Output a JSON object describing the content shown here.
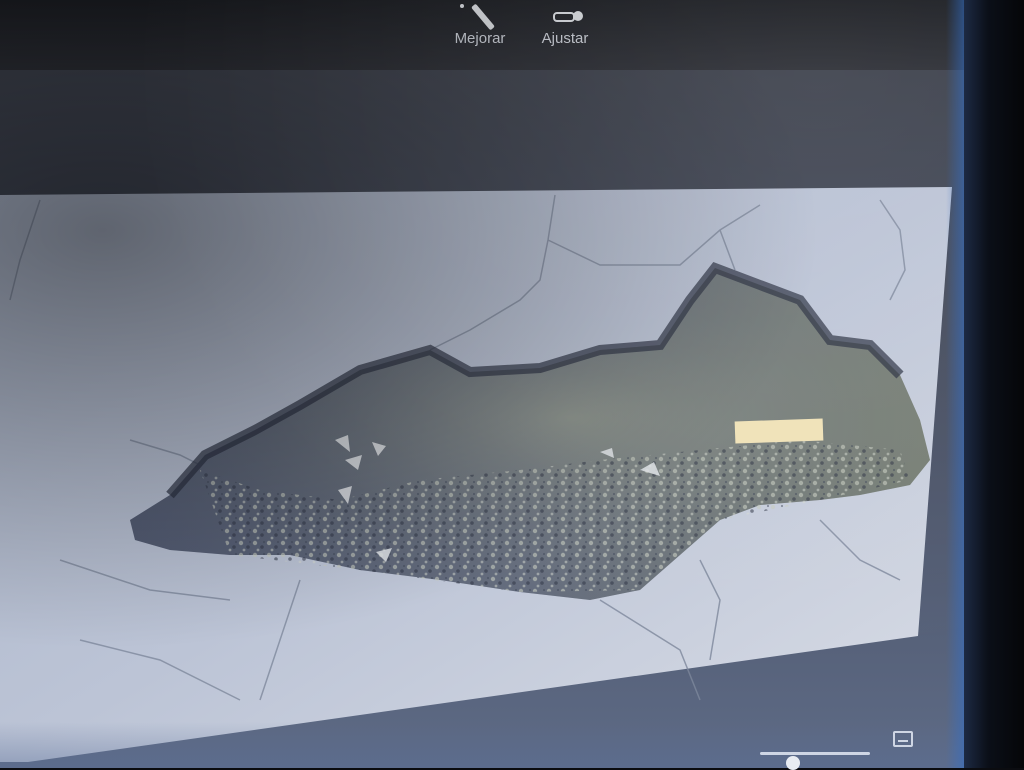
{
  "toolbar": {
    "enhance_label": "Mejorar",
    "adjust_label": "Ajustar",
    "enhance_icon": "magic-wand-icon",
    "adjust_icon": "adjust-sliders-icon"
  },
  "viewer": {
    "photo_subject": "",
    "fit_icon": "fit-to-window-icon"
  },
  "colors": {
    "toolbar_bg": "#1f2127",
    "toolbar_text": "#c8ccd4",
    "viewer_bg": "#4c5468",
    "photo_asphalt": "#b6bfd2",
    "pothole_dark": "#3a4256"
  }
}
